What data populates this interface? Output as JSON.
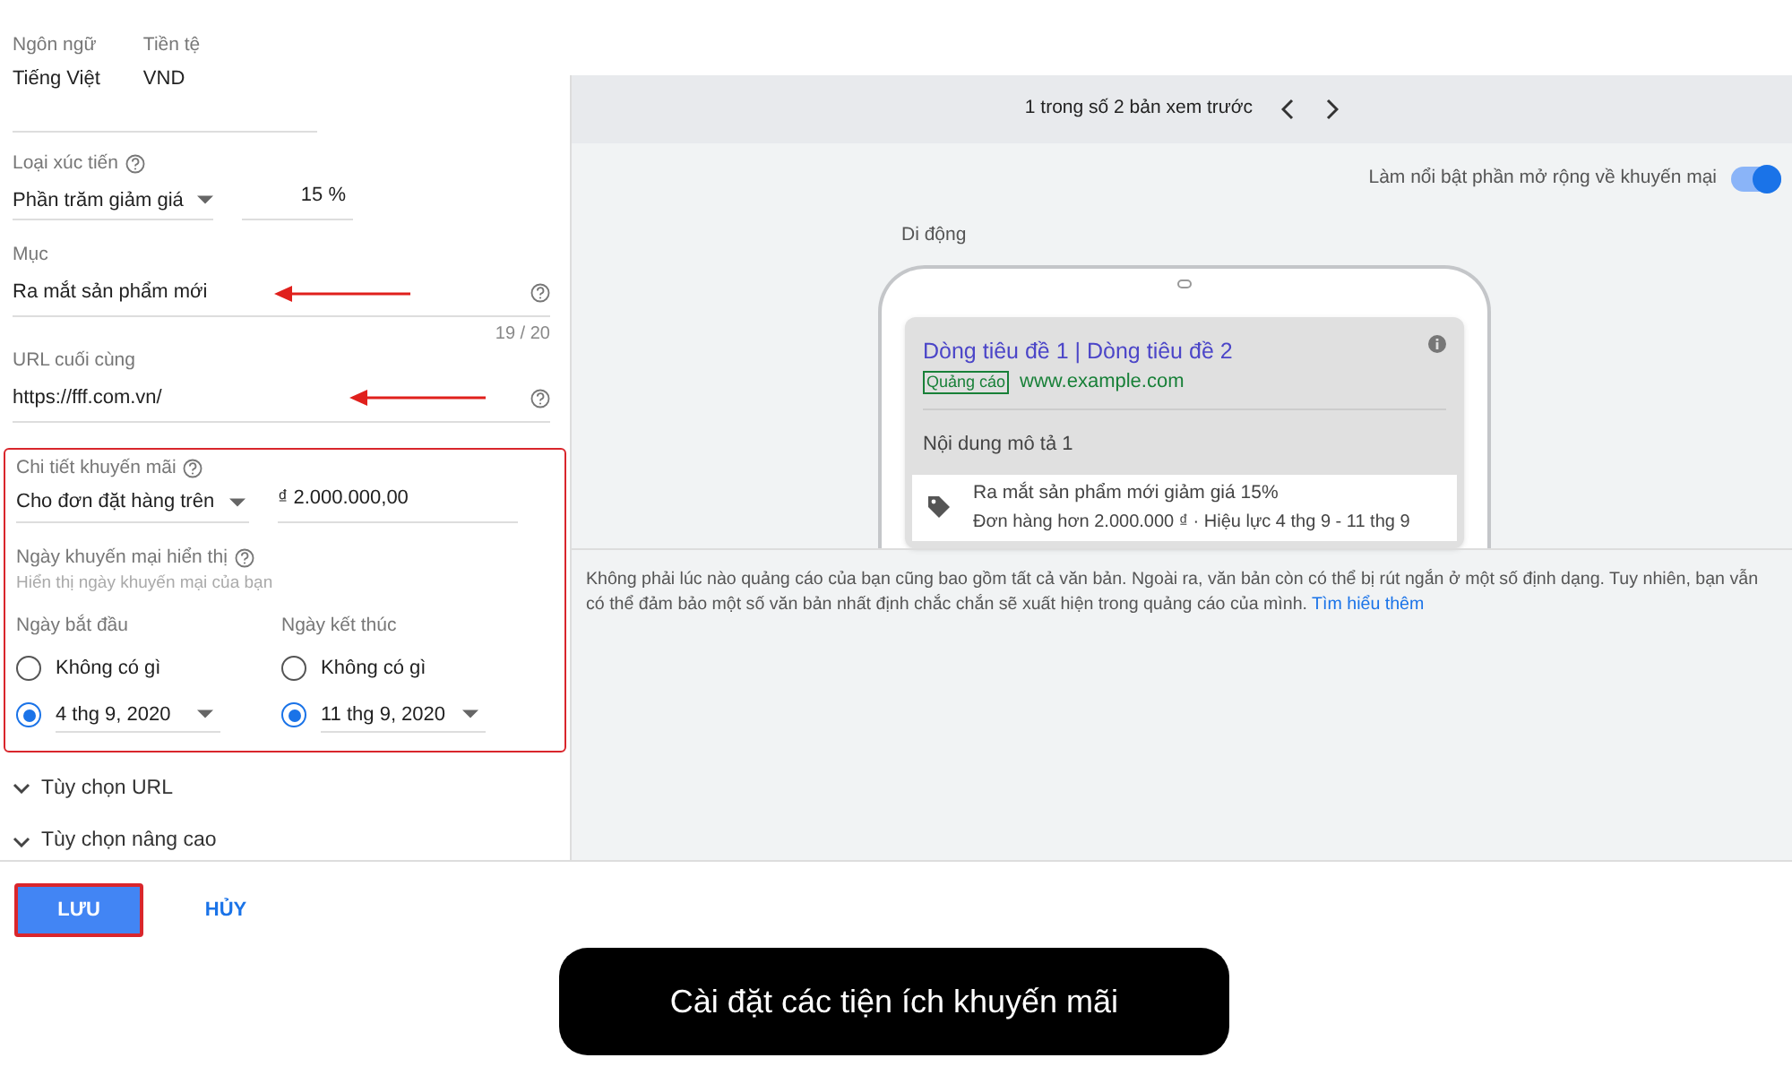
{
  "form": {
    "language": {
      "label": "Ngôn ngữ",
      "value": "Tiếng Việt"
    },
    "currency": {
      "label": "Tiền tệ",
      "value": "VND"
    },
    "promotion_type": {
      "label": "Loại xúc tiến",
      "value": "Phần trăm giảm giá",
      "amount": "15 %"
    },
    "item": {
      "label": "Mục",
      "value": "Ra mắt sản phẩm mới",
      "counter": "19 / 20"
    },
    "final_url": {
      "label": "URL cuối cùng",
      "value": "https://fff.com.vn/"
    },
    "promotion_details": {
      "label": "Chi tiết khuyến mãi",
      "condition": "Cho đơn đặt hàng trên",
      "amount": "₫ 2.000.000,00"
    },
    "display_dates": {
      "label": "Ngày khuyến mại hiển thị",
      "hint": "Hiển thị ngày khuyến mại của bạn",
      "columns": [
        {
          "label": "Ngày bắt đầu",
          "options": [
            {
              "kind": "none",
              "label": "Không có gì",
              "selected": false
            },
            {
              "kind": "date",
              "label": "4 thg 9, 2020",
              "selected": true
            }
          ]
        },
        {
          "label": "Ngày kết thúc",
          "options": [
            {
              "kind": "none",
              "label": "Không có gì",
              "selected": false
            },
            {
              "kind": "date",
              "label": "11 thg 9, 2020",
              "selected": true
            }
          ]
        }
      ]
    },
    "sections": [
      {
        "label": "Tùy chọn URL",
        "expanded": false
      },
      {
        "label": "Tùy chọn nâng cao",
        "expanded": false
      }
    ]
  },
  "actions": [
    {
      "label": "LƯU",
      "kind": "primary"
    },
    {
      "label": "HỦY",
      "kind": "text"
    }
  ],
  "preview": {
    "pager": "1 trong số 2 bản xem trước",
    "highlight_toggle": {
      "label": "Làm nổi bật phần mở rộng về khuyến mại",
      "on": true
    },
    "device": "Di động",
    "ad": {
      "headline": "Dòng tiêu đề 1 | Dòng tiêu đề 2",
      "badge": "Quảng cáo",
      "url": "www.example.com",
      "description": "Nội dung mô tả 1",
      "promo_title": "Ra mắt sản phẩm mới giảm giá 15%",
      "promo_details": "Đơn hàng hơn 2.000.000 ₫ · Hiệu lực 4 thg 9 - 11 thg 9"
    },
    "note": "Không phải lúc nào quảng cáo của bạn cũng bao gồm tất cả văn bản. Ngoài ra, văn bản còn có thể bị rút ngắn ở một số định dạng. Tuy nhiên, bạn vẫn có thể đảm bảo một số văn bản nhất định chắc chắn sẽ xuất hiện trong quảng cáo của mình.",
    "note_link": "Tìm hiểu thêm"
  },
  "caption": "Cài đặt các tiện ích khuyến mãi"
}
